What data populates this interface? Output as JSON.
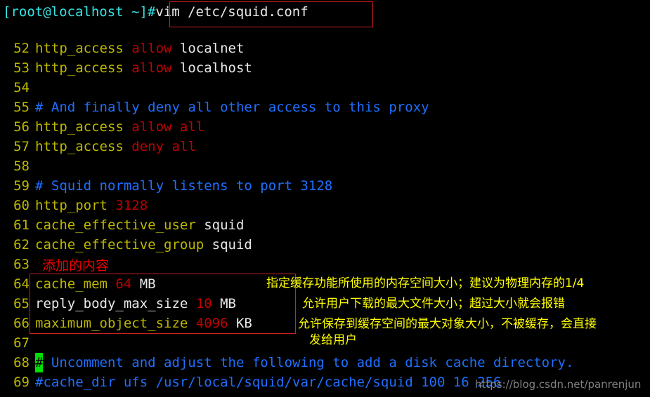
{
  "shell": {
    "prompt": "[root@localhost ~]#",
    "command": "vim /etc/squid.conf"
  },
  "editor": {
    "lines": [
      {
        "num": "52",
        "segments": [
          {
            "t": "http_access ",
            "c": "c-yellow"
          },
          {
            "t": "allow ",
            "c": "c-red"
          },
          {
            "t": "localnet",
            "c": "c-white"
          }
        ]
      },
      {
        "num": "53",
        "segments": [
          {
            "t": "http_access ",
            "c": "c-yellow"
          },
          {
            "t": "allow ",
            "c": "c-red"
          },
          {
            "t": "localhost",
            "c": "c-white"
          }
        ]
      },
      {
        "num": "54",
        "segments": []
      },
      {
        "num": "55",
        "segments": [
          {
            "t": "# And finally deny all other access to this proxy",
            "c": "c-blue"
          }
        ]
      },
      {
        "num": "56",
        "segments": [
          {
            "t": "http_access ",
            "c": "c-yellow"
          },
          {
            "t": "allow all",
            "c": "c-red"
          }
        ]
      },
      {
        "num": "57",
        "segments": [
          {
            "t": "http_access ",
            "c": "c-yellow"
          },
          {
            "t": "deny all",
            "c": "c-red"
          }
        ]
      },
      {
        "num": "58",
        "segments": []
      },
      {
        "num": "59",
        "segments": [
          {
            "t": "# Squid normally listens to port 3128",
            "c": "c-blue"
          }
        ]
      },
      {
        "num": "60",
        "segments": [
          {
            "t": "http_port ",
            "c": "c-yellow"
          },
          {
            "t": "3128",
            "c": "c-red"
          }
        ]
      },
      {
        "num": "61",
        "segments": [
          {
            "t": "cache_effective_user ",
            "c": "c-yellow"
          },
          {
            "t": "squid",
            "c": "c-white"
          }
        ]
      },
      {
        "num": "62",
        "segments": [
          {
            "t": "cache_effective_group ",
            "c": "c-yellow"
          },
          {
            "t": "squid",
            "c": "c-white"
          }
        ]
      },
      {
        "num": "63",
        "segments": []
      },
      {
        "num": "64",
        "segments": [
          {
            "t": "cache_mem ",
            "c": "c-yellow"
          },
          {
            "t": "64",
            "c": "c-red"
          },
          {
            "t": " MB",
            "c": "c-white"
          }
        ]
      },
      {
        "num": "65",
        "segments": [
          {
            "t": "reply_body_max_size ",
            "c": "c-white"
          },
          {
            "t": "10",
            "c": "c-red"
          },
          {
            "t": " MB",
            "c": "c-white"
          }
        ]
      },
      {
        "num": "66",
        "segments": [
          {
            "t": "maximum_object_size ",
            "c": "c-yellow"
          },
          {
            "t": "4096",
            "c": "c-red"
          },
          {
            "t": " KB",
            "c": "c-white"
          }
        ]
      },
      {
        "num": "67",
        "segments": []
      },
      {
        "num": "68",
        "segments": [
          {
            "t": "#",
            "c": "cursor"
          },
          {
            "t": " Uncomment and adjust the following to add a disk cache directory.",
            "c": "c-blue"
          }
        ]
      },
      {
        "num": "69",
        "segments": [
          {
            "t": "#cache_dir ufs /usr/local/squid/var/cache/squid 100 16 256",
            "c": "c-blue"
          }
        ]
      }
    ]
  },
  "annotations": {
    "added_content_label": "添加的内容",
    "cache_mem_note": "指定缓存功能所使用的内存空间大小；建议为物理内存的1/4",
    "reply_body_note": "允许用户下载的最大文件大小；超过大小就会报错",
    "max_object_note_line1": "允许保存到缓存空间的最大对象大小，不被缓存，会直接",
    "max_object_note_line2": "发给用户"
  },
  "watermark": {
    "text": "https://blog.csdn.net/panrenjun"
  },
  "colors": {
    "background": "#000000",
    "prompt": "#35e5e5",
    "comment": "#1f6fff",
    "directive": "#bdb800",
    "value": "#c00000",
    "annotation": "#ffff00",
    "highlight_box": "#d02020",
    "cursor": "#00dd00"
  }
}
